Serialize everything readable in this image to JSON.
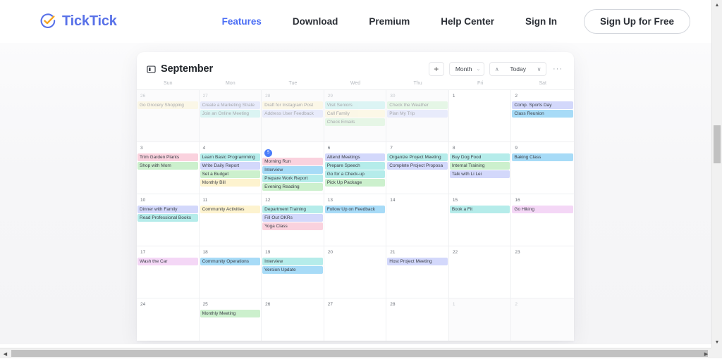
{
  "brand": {
    "name": "TickTick",
    "logo_icon": "check-circle-icon",
    "color": "#5871e8",
    "check_color": "#f5a623"
  },
  "nav": {
    "links": [
      {
        "label": "Features",
        "active": true
      },
      {
        "label": "Download",
        "active": false
      },
      {
        "label": "Premium",
        "active": false
      },
      {
        "label": "Help Center",
        "active": false
      },
      {
        "label": "Sign In",
        "active": false
      }
    ],
    "cta_label": "Sign Up for Free"
  },
  "calendar": {
    "panel_icon": "sidebar-panel-icon",
    "title": "September",
    "toolbar": {
      "add_label": "+",
      "view_label": "Month",
      "view_caret": "⌄",
      "prev_icon": "chevron-up-icon",
      "next_icon": "chevron-down-icon",
      "prev_glyph": "∧",
      "next_glyph": "∨",
      "today_label": "Today",
      "more_label": "···"
    },
    "day_headers": [
      "Sun",
      "Mon",
      "Tue",
      "Wed",
      "Thu",
      "Fri",
      "Sat"
    ],
    "event_colors": {
      "yellow": "#fdf3cf",
      "purple": "#d3d8fb",
      "teal": "#b5ecea",
      "green": "#ccf0cd",
      "blue": "#a7dbf7",
      "pink": "#fad2de",
      "magenta": "#f4d7f6"
    },
    "weeks": [
      [
        {
          "num": "26",
          "out": true,
          "events": [
            {
              "title": "Go Grocery Shopping",
              "color": "yellow"
            }
          ]
        },
        {
          "num": "27",
          "out": true,
          "events": [
            {
              "title": "Create a Marketing Strate",
              "color": "purple"
            },
            {
              "title": "Join an Online Meeting",
              "color": "teal"
            }
          ]
        },
        {
          "num": "28",
          "out": true,
          "events": [
            {
              "title": "Draft for Instagram Post",
              "color": "yellow"
            },
            {
              "title": "Address User Feedback",
              "color": "purple"
            }
          ]
        },
        {
          "num": "29",
          "out": true,
          "events": [
            {
              "title": "Visit Seniors",
              "color": "teal"
            },
            {
              "title": "Call Family",
              "color": "yellow"
            },
            {
              "title": "Check Emails",
              "color": "green"
            }
          ]
        },
        {
          "num": "30",
          "out": true,
          "events": [
            {
              "title": "Check the Weather",
              "color": "green"
            },
            {
              "title": "Plan My Trip",
              "color": "purple"
            }
          ]
        },
        {
          "num": "1",
          "out": false,
          "events": []
        },
        {
          "num": "2",
          "out": false,
          "events": [
            {
              "title": "Comp. Sports Day",
              "color": "purple"
            },
            {
              "title": "Class Reunion",
              "color": "blue"
            }
          ]
        }
      ],
      [
        {
          "num": "3",
          "out": false,
          "events": [
            {
              "title": "Trim Garden Plants",
              "color": "pink"
            },
            {
              "title": "Shop with Mom",
              "color": "green"
            }
          ]
        },
        {
          "num": "4",
          "out": false,
          "events": [
            {
              "title": "Learn Basic Programming",
              "color": "teal"
            },
            {
              "title": "Write Daily Report",
              "color": "purple"
            },
            {
              "title": "Set a Budget",
              "color": "green"
            },
            {
              "title": "Monthly Bill",
              "color": "yellow"
            }
          ]
        },
        {
          "num": "5",
          "out": false,
          "today": true,
          "events": [
            {
              "title": "Morning Run",
              "color": "pink"
            },
            {
              "title": "Interview",
              "color": "blue"
            },
            {
              "title": "Prepare Work Report",
              "color": "teal"
            },
            {
              "title": "Evening Reading",
              "color": "green"
            }
          ]
        },
        {
          "num": "6",
          "out": false,
          "events": [
            {
              "title": "Attend Meetings",
              "color": "purple"
            },
            {
              "title": "Prepare Speech",
              "color": "teal"
            },
            {
              "title": "Go for a Check-up",
              "color": "teal"
            },
            {
              "title": "Pick Up Package",
              "color": "green"
            }
          ]
        },
        {
          "num": "7",
          "out": false,
          "events": [
            {
              "title": "Organize Project Meeting",
              "color": "teal"
            },
            {
              "title": "Complete Project Proposa",
              "color": "purple"
            }
          ]
        },
        {
          "num": "8",
          "out": false,
          "events": [
            {
              "title": "Buy Dog Food",
              "color": "teal"
            },
            {
              "title": "Internal Training",
              "color": "green"
            },
            {
              "title": "Talk with Li Lei",
              "color": "purple"
            }
          ]
        },
        {
          "num": "9",
          "out": false,
          "events": [
            {
              "title": "Baking Class",
              "color": "blue"
            }
          ]
        }
      ],
      [
        {
          "num": "10",
          "out": false,
          "events": [
            {
              "title": "Dinner with Family",
              "color": "purple"
            },
            {
              "title": "Read Professional Books",
              "color": "teal"
            }
          ]
        },
        {
          "num": "11",
          "out": false,
          "events": [
            {
              "title": "Community Activities",
              "color": "yellow"
            }
          ]
        },
        {
          "num": "12",
          "out": false,
          "events": [
            {
              "title": "Department Training",
              "color": "teal"
            },
            {
              "title": "Fill Out OKRs",
              "color": "purple"
            },
            {
              "title": "Yoga Class",
              "color": "pink"
            }
          ]
        },
        {
          "num": "13",
          "out": false,
          "events": [
            {
              "title": "Follow Up on Feedback",
              "color": "blue"
            }
          ]
        },
        {
          "num": "14",
          "out": false,
          "events": []
        },
        {
          "num": "15",
          "out": false,
          "events": [
            {
              "title": "Book a Fit",
              "color": "teal"
            }
          ]
        },
        {
          "num": "16",
          "out": false,
          "events": [
            {
              "title": "Go Hiking",
              "color": "magenta"
            }
          ]
        }
      ],
      [
        {
          "num": "17",
          "out": false,
          "events": [
            {
              "title": "Wash the Car",
              "color": "magenta"
            }
          ]
        },
        {
          "num": "18",
          "out": false,
          "events": [
            {
              "title": "Community Operations",
              "color": "blue"
            }
          ]
        },
        {
          "num": "19",
          "out": false,
          "events": [
            {
              "title": "Interview",
              "color": "teal"
            },
            {
              "title": "Version Update",
              "color": "blue"
            }
          ]
        },
        {
          "num": "20",
          "out": false,
          "events": []
        },
        {
          "num": "21",
          "out": false,
          "events": [
            {
              "title": "Host Project Meeting",
              "color": "purple"
            }
          ]
        },
        {
          "num": "22",
          "out": false,
          "events": []
        },
        {
          "num": "23",
          "out": false,
          "events": []
        }
      ],
      [
        {
          "num": "24",
          "out": false,
          "events": []
        },
        {
          "num": "25",
          "out": false,
          "events": [
            {
              "title": "Monthly Meeting",
              "color": "green"
            }
          ]
        },
        {
          "num": "26",
          "out": false,
          "events": []
        },
        {
          "num": "27",
          "out": false,
          "events": []
        },
        {
          "num": "28",
          "out": false,
          "events": []
        },
        {
          "num": "1",
          "out": true,
          "events": []
        },
        {
          "num": "2",
          "out": true,
          "events": []
        }
      ]
    ]
  },
  "scrollbars": {
    "up_glyph": "▲",
    "down_glyph": "▼",
    "left_glyph": "◀",
    "right_glyph": "▶"
  }
}
